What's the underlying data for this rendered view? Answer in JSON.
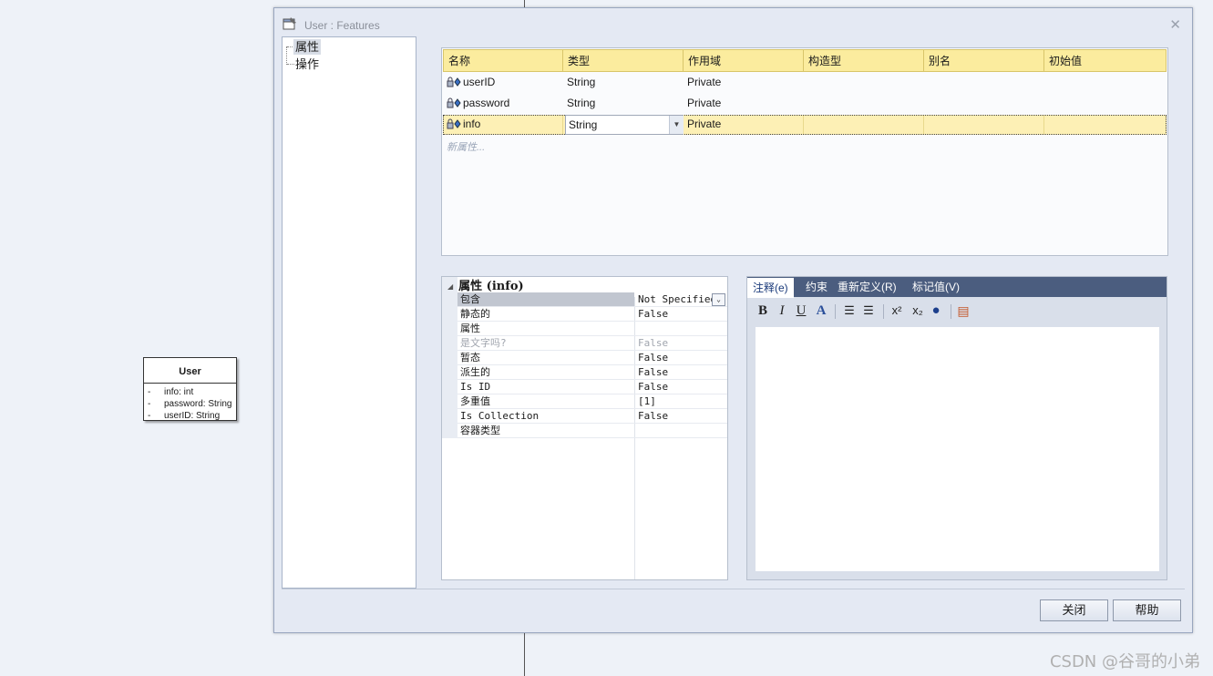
{
  "dialog": {
    "title": "User : Features"
  },
  "tree": {
    "items": [
      {
        "label": "属性",
        "selected": true
      },
      {
        "label": "操作",
        "selected": false
      }
    ]
  },
  "attributes_grid": {
    "columns": [
      "名称",
      "类型",
      "作用域",
      "构造型",
      "别名",
      "初始值"
    ],
    "rows": [
      {
        "name": "userID",
        "type": "String",
        "scope": "Private",
        "stereotype": "",
        "alias": "",
        "initial": ""
      },
      {
        "name": "password",
        "type": "String",
        "scope": "Private",
        "stereotype": "",
        "alias": "",
        "initial": ""
      },
      {
        "name": "info",
        "type": "String",
        "scope": "Private",
        "stereotype": "",
        "alias": "",
        "initial": "",
        "selected": true
      }
    ],
    "new_attribute_placeholder": "新属性..."
  },
  "properties": {
    "header": "属性 (info)",
    "rows": [
      {
        "name": "包含",
        "value": "Not Specified",
        "selected": true
      },
      {
        "name": "静态的",
        "value": "False"
      },
      {
        "name": "属性",
        "value": ""
      },
      {
        "name": "是文字吗?",
        "value": "False",
        "disabled": true
      },
      {
        "name": "暂态",
        "value": "False"
      },
      {
        "name": "派生的",
        "value": "False"
      },
      {
        "name": "Is ID",
        "value": "False"
      },
      {
        "name": "多重值",
        "value": "[1]"
      },
      {
        "name": "Is Collection",
        "value": "False"
      },
      {
        "name": "容器类型",
        "value": ""
      }
    ]
  },
  "notes": {
    "tabs": [
      {
        "label": "注释(e)",
        "active": true
      },
      {
        "label": "约束"
      },
      {
        "label": "重新定义(R)"
      },
      {
        "label": "标记值(V)"
      }
    ],
    "toolbar": {
      "bold": "B",
      "italic": "I",
      "underline": "U",
      "font_color": "A",
      "bullet_list": "☰",
      "numbered_list": "☰",
      "superscript": "x²",
      "subscript": "x₂",
      "hyperlink": "●",
      "document": "▤"
    },
    "text": ""
  },
  "buttons": {
    "close": "关闭",
    "help": "帮助"
  },
  "diagram": {
    "class_name": "User",
    "attributes": [
      {
        "visibility": "-",
        "text": "info: int"
      },
      {
        "visibility": "-",
        "text": "password: String"
      },
      {
        "visibility": "-",
        "text": "userID: String"
      }
    ]
  },
  "watermark": "CSDN @谷哥的小弟",
  "colors": {
    "grid_header": "#fbec9e",
    "selected_row": "#fdf0b5",
    "notes_tab_bar": "#4b5d7f",
    "dialog_bg": "#e4e9f3"
  }
}
